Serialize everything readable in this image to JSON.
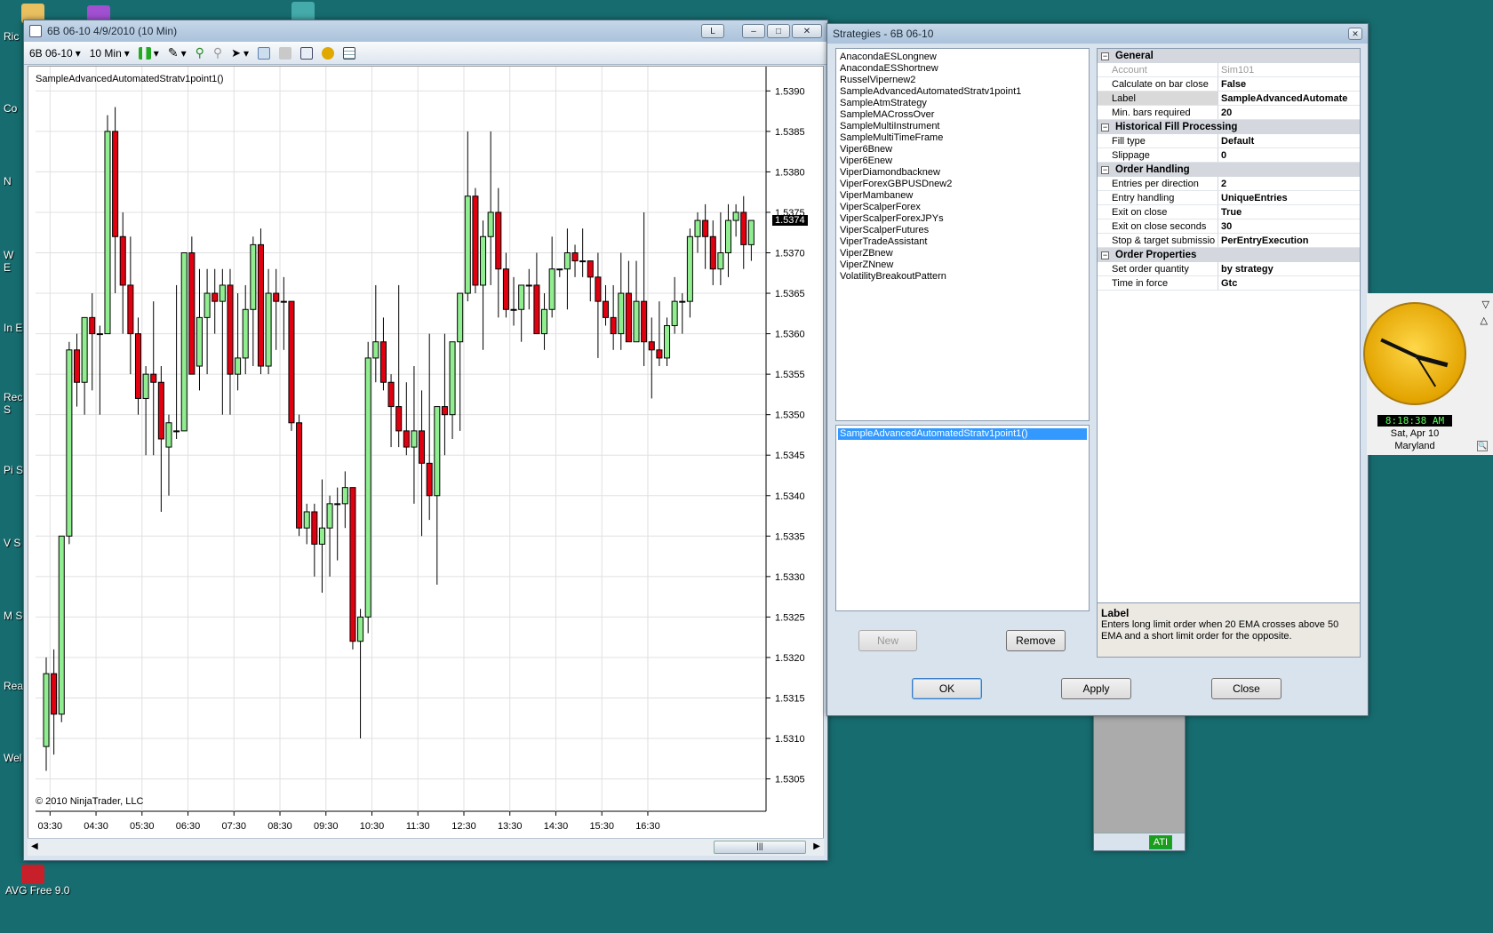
{
  "desktop": {
    "labels": [
      "Ric",
      "Co",
      "N",
      "W E",
      "In E",
      "Rec S",
      "Pi S",
      "V S",
      "M S",
      "Rea",
      "Wel"
    ],
    "avg_label": "AVG Free 9.0"
  },
  "chart_window": {
    "title": "6B 06-10  4/9/2010 (10 Min)",
    "toolbar": {
      "instrument": "6B 06-10",
      "period": "10 Min"
    },
    "strategy_label": "SampleAdvancedAutomatedStratv1point1()",
    "copyright": "© 2010 NinjaTrader, LLC",
    "last_price": "1.5374"
  },
  "chart_data": {
    "type": "candlestick",
    "xlabels": [
      "03:30",
      "04:30",
      "05:30",
      "06:30",
      "07:30",
      "08:30",
      "09:30",
      "10:30",
      "11:30",
      "12:30",
      "13:30",
      "14:30",
      "15:30",
      "16:30"
    ],
    "yticks": [
      "1.5390",
      "1.5385",
      "1.5380",
      "1.5375",
      "1.5370",
      "1.5365",
      "1.5360",
      "1.5355",
      "1.5350",
      "1.5345",
      "1.5340",
      "1.5335",
      "1.5330",
      "1.5325",
      "1.5320",
      "1.5315",
      "1.5310",
      "1.5305"
    ],
    "ylim": [
      1.5301,
      1.5393
    ],
    "candles": [
      [
        1.5309,
        1.532,
        1.5306,
        1.5318
      ],
      [
        1.5318,
        1.5321,
        1.5308,
        1.5313
      ],
      [
        1.5313,
        1.5335,
        1.5312,
        1.5335
      ],
      [
        1.5335,
        1.5359,
        1.5334,
        1.5358
      ],
      [
        1.5358,
        1.536,
        1.5351,
        1.5354
      ],
      [
        1.5354,
        1.5362,
        1.535,
        1.5362
      ],
      [
        1.5362,
        1.5365,
        1.5353,
        1.536
      ],
      [
        1.536,
        1.5361,
        1.535,
        1.536
      ],
      [
        1.536,
        1.5387,
        1.536,
        1.5385
      ],
      [
        1.5385,
        1.5388,
        1.5365,
        1.5372
      ],
      [
        1.5372,
        1.5375,
        1.536,
        1.5366
      ],
      [
        1.5366,
        1.5372,
        1.5355,
        1.536
      ],
      [
        1.536,
        1.5362,
        1.535,
        1.5352
      ],
      [
        1.5352,
        1.5356,
        1.5345,
        1.5355
      ],
      [
        1.5355,
        1.5364,
        1.5345,
        1.5354
      ],
      [
        1.5354,
        1.5356,
        1.5338,
        1.5347
      ],
      [
        1.5346,
        1.535,
        1.534,
        1.5349
      ],
      [
        1.5348,
        1.5366,
        1.5347,
        1.5348
      ],
      [
        1.5348,
        1.537,
        1.5348,
        1.537
      ],
      [
        1.537,
        1.5372,
        1.5355,
        1.5355
      ],
      [
        1.5356,
        1.5368,
        1.5353,
        1.5362
      ],
      [
        1.5362,
        1.5368,
        1.5355,
        1.5365
      ],
      [
        1.5365,
        1.5368,
        1.536,
        1.5364
      ],
      [
        1.5364,
        1.5368,
        1.535,
        1.5366
      ],
      [
        1.5366,
        1.5368,
        1.535,
        1.5355
      ],
      [
        1.5355,
        1.5365,
        1.5353,
        1.5357
      ],
      [
        1.5357,
        1.5366,
        1.5355,
        1.5363
      ],
      [
        1.5363,
        1.5372,
        1.5356,
        1.5371
      ],
      [
        1.5371,
        1.5373,
        1.5355,
        1.5356
      ],
      [
        1.5356,
        1.5368,
        1.5355,
        1.5365
      ],
      [
        1.5365,
        1.5368,
        1.5358,
        1.5364
      ],
      [
        1.5364,
        1.5367,
        1.5358,
        1.5364
      ],
      [
        1.5364,
        1.5364,
        1.5348,
        1.5349
      ],
      [
        1.5349,
        1.535,
        1.5335,
        1.5336
      ],
      [
        1.5336,
        1.5339,
        1.5334,
        1.5338
      ],
      [
        1.5338,
        1.5339,
        1.533,
        1.5334
      ],
      [
        1.5334,
        1.5342,
        1.5328,
        1.5336
      ],
      [
        1.5336,
        1.534,
        1.533,
        1.5339
      ],
      [
        1.5339,
        1.5341,
        1.5332,
        1.5339
      ],
      [
        1.5339,
        1.5343,
        1.5336,
        1.5341
      ],
      [
        1.5341,
        1.5341,
        1.5321,
        1.5322
      ],
      [
        1.5322,
        1.5326,
        1.531,
        1.5325
      ],
      [
        1.5325,
        1.5359,
        1.5323,
        1.5357
      ],
      [
        1.5357,
        1.5366,
        1.5354,
        1.5359
      ],
      [
        1.5359,
        1.5362,
        1.5353,
        1.5354
      ],
      [
        1.5354,
        1.5355,
        1.5346,
        1.5351
      ],
      [
        1.5351,
        1.5366,
        1.5346,
        1.5348
      ],
      [
        1.5348,
        1.5354,
        1.5345,
        1.5346
      ],
      [
        1.5346,
        1.5356,
        1.5339,
        1.5348
      ],
      [
        1.5348,
        1.5353,
        1.5335,
        1.5344
      ],
      [
        1.5344,
        1.536,
        1.5337,
        1.534
      ],
      [
        1.534,
        1.5351,
        1.5329,
        1.5351
      ],
      [
        1.5351,
        1.536,
        1.5345,
        1.535
      ],
      [
        1.535,
        1.5359,
        1.5347,
        1.5359
      ],
      [
        1.5359,
        1.5365,
        1.5348,
        1.5365
      ],
      [
        1.5365,
        1.5385,
        1.5364,
        1.5377
      ],
      [
        1.5377,
        1.5378,
        1.5365,
        1.5366
      ],
      [
        1.5366,
        1.5374,
        1.5358,
        1.5372
      ],
      [
        1.5372,
        1.5385,
        1.5366,
        1.5375
      ],
      [
        1.5375,
        1.5378,
        1.5362,
        1.5368
      ],
      [
        1.5368,
        1.537,
        1.5362,
        1.5363
      ],
      [
        1.5363,
        1.5367,
        1.5361,
        1.5363
      ],
      [
        1.5363,
        1.5366,
        1.5359,
        1.5366
      ],
      [
        1.5366,
        1.5368,
        1.5363,
        1.5366
      ],
      [
        1.5366,
        1.537,
        1.536,
        1.536
      ],
      [
        1.536,
        1.5365,
        1.5358,
        1.5363
      ],
      [
        1.5363,
        1.5372,
        1.5362,
        1.5368
      ],
      [
        1.5368,
        1.5368,
        1.5367,
        1.5368
      ],
      [
        1.5368,
        1.5373,
        1.5363,
        1.537
      ],
      [
        1.537,
        1.5371,
        1.5367,
        1.5369
      ],
      [
        1.5369,
        1.5373,
        1.5367,
        1.5369
      ],
      [
        1.5369,
        1.5369,
        1.5364,
        1.5367
      ],
      [
        1.5367,
        1.537,
        1.5357,
        1.5364
      ],
      [
        1.5364,
        1.5366,
        1.5361,
        1.5362
      ],
      [
        1.5362,
        1.5366,
        1.5358,
        1.536
      ],
      [
        1.536,
        1.537,
        1.5358,
        1.5365
      ],
      [
        1.5365,
        1.5369,
        1.536,
        1.5359
      ],
      [
        1.5359,
        1.5369,
        1.5359,
        1.5364
      ],
      [
        1.5364,
        1.5375,
        1.5356,
        1.5359
      ],
      [
        1.5359,
        1.5362,
        1.5352,
        1.5358
      ],
      [
        1.5358,
        1.5364,
        1.5356,
        1.5357
      ],
      [
        1.5357,
        1.5362,
        1.5356,
        1.5361
      ],
      [
        1.5361,
        1.5367,
        1.536,
        1.5364
      ],
      [
        1.5364,
        1.5365,
        1.536,
        1.5364
      ],
      [
        1.5364,
        1.5373,
        1.5362,
        1.5372
      ],
      [
        1.5372,
        1.5375,
        1.537,
        1.5374
      ],
      [
        1.5374,
        1.5376,
        1.5368,
        1.5372
      ],
      [
        1.5372,
        1.5374,
        1.5366,
        1.5368
      ],
      [
        1.5368,
        1.5375,
        1.5366,
        1.537
      ],
      [
        1.537,
        1.5376,
        1.5367,
        1.5374
      ],
      [
        1.5374,
        1.5376,
        1.5372,
        1.5375
      ],
      [
        1.5375,
        1.5377,
        1.5368,
        1.5371
      ],
      [
        1.5371,
        1.5373,
        1.5369,
        1.5374
      ]
    ]
  },
  "strategies_dialog": {
    "title": "Strategies - 6B 06-10",
    "available": [
      "AnacondaESLongnew",
      "AnacondaESShortnew",
      "RusselVipernew2",
      "SampleAdvancedAutomatedStratv1point1",
      "SampleAtmStrategy",
      "SampleMACrossOver",
      "SampleMultiInstrument",
      "SampleMultiTimeFrame",
      "Viper6Bnew",
      "Viper6Enew",
      "ViperDiamondbacknew",
      "ViperForexGBPUSDnew2",
      "ViperMambanew",
      "ViperScalperForex",
      "ViperScalperForexJPYs",
      "ViperScalperFutures",
      "ViperTradeAssistant",
      "ViperZBnew",
      "ViperZNnew",
      "VolatilityBreakoutPattern"
    ],
    "configured": [
      "SampleAdvancedAutomatedStratv1point1()"
    ],
    "buttons": {
      "new": "New",
      "remove": "Remove",
      "ok": "OK",
      "apply": "Apply",
      "close": "Close"
    },
    "properties": [
      {
        "category": "General",
        "rows": [
          {
            "key": "Account",
            "value": "Sim101",
            "disabled": true
          },
          {
            "key": "Calculate on bar close",
            "value": "False"
          },
          {
            "key": "Label",
            "value": "SampleAdvancedAutomate",
            "selected": true
          },
          {
            "key": "Min. bars required",
            "value": "20"
          }
        ]
      },
      {
        "category": "Historical Fill Processing",
        "rows": [
          {
            "key": "Fill type",
            "value": "Default"
          },
          {
            "key": "Slippage",
            "value": "0"
          }
        ]
      },
      {
        "category": "Order Handling",
        "rows": [
          {
            "key": "Entries per direction",
            "value": "2"
          },
          {
            "key": "Entry handling",
            "value": "UniqueEntries"
          },
          {
            "key": "Exit on close",
            "value": "True"
          },
          {
            "key": "Exit on close seconds",
            "value": "30"
          },
          {
            "key": "Stop & target submissio",
            "value": "PerEntryExecution"
          }
        ]
      },
      {
        "category": "Order Properties",
        "rows": [
          {
            "key": "Set order quantity",
            "value": "by strategy"
          },
          {
            "key": "Time in force",
            "value": "Gtc"
          }
        ]
      }
    ],
    "help": {
      "title": "Label",
      "text": "Enters long limit order when 20 EMA crosses above 50 EMA and a short limit order for the opposite."
    }
  },
  "back_window": {
    "status": "ATI"
  },
  "clock_gadget": {
    "time": "8:18:38 AM",
    "date": "Sat, Apr 10",
    "location": "Maryland"
  }
}
